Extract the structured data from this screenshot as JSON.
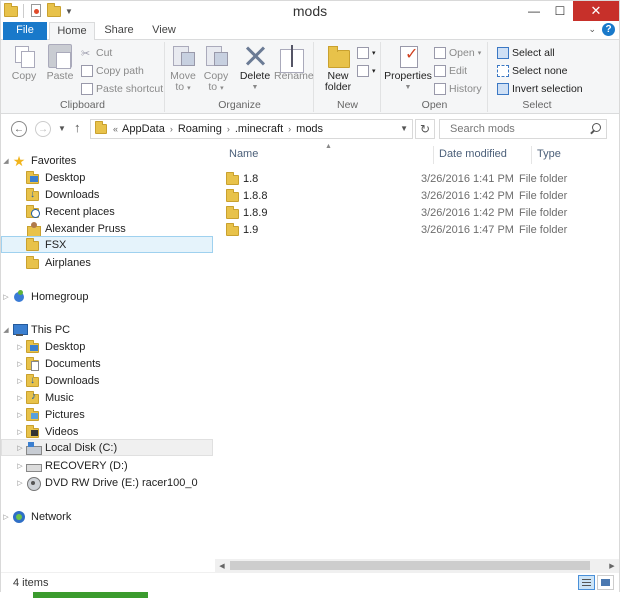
{
  "window": {
    "title": "mods",
    "controls": {
      "minimize": "—",
      "maximize": "☐",
      "close": "✕"
    }
  },
  "ribbon_tabs": [
    "File",
    "Home",
    "Share",
    "View"
  ],
  "ribbon": {
    "clipboard": {
      "label": "Clipboard",
      "copy": "Copy",
      "paste": "Paste",
      "cut": "Cut",
      "copy_path": "Copy path",
      "paste_shortcut": "Paste shortcut"
    },
    "organize": {
      "label": "Organize",
      "move_to": "Move",
      "move_to_2": "to",
      "copy_to": "Copy",
      "copy_to_2": "to",
      "delete": "Delete",
      "rename": "Rename"
    },
    "new": {
      "label": "New",
      "new_folder": "New",
      "new_folder_2": "folder"
    },
    "open": {
      "label": "Open",
      "properties": "Properties",
      "open": "Open",
      "edit": "Edit",
      "history": "History"
    },
    "select": {
      "label": "Select",
      "select_all": "Select all",
      "select_none": "Select none",
      "invert_selection": "Invert selection"
    }
  },
  "address": {
    "overflow": "«",
    "breadcrumbs": [
      "AppData",
      "Roaming",
      ".minecraft",
      "mods"
    ],
    "search_placeholder": "Search mods"
  },
  "nav_pane": {
    "favorites": {
      "label": "Favorites",
      "items": [
        "Desktop",
        "Downloads",
        "Recent places",
        "Alexander Pruss",
        "FSX",
        "Airplanes"
      ]
    },
    "homegroup": "Homegroup",
    "this_pc": {
      "label": "This PC",
      "items": [
        "Desktop",
        "Documents",
        "Downloads",
        "Music",
        "Pictures",
        "Videos",
        "Local Disk (C:)",
        "RECOVERY (D:)",
        "DVD RW Drive (E:) racer100_0"
      ]
    },
    "network": "Network"
  },
  "columns": {
    "name": "Name",
    "date": "Date modified",
    "type": "Type"
  },
  "files": [
    {
      "name": "1.8",
      "date": "3/26/2016 1:41 PM",
      "type": "File folder"
    },
    {
      "name": "1.8.8",
      "date": "3/26/2016 1:42 PM",
      "type": "File folder"
    },
    {
      "name": "1.8.9",
      "date": "3/26/2016 1:42 PM",
      "type": "File folder"
    },
    {
      "name": "1.9",
      "date": "3/26/2016 1:47 PM",
      "type": "File folder"
    }
  ],
  "status": {
    "item_count": "4 items"
  },
  "colors": {
    "file_tab": "#1979ca",
    "close_button": "#c7302a",
    "folder": "#e8c24a",
    "selection": "#e5f3fb"
  }
}
